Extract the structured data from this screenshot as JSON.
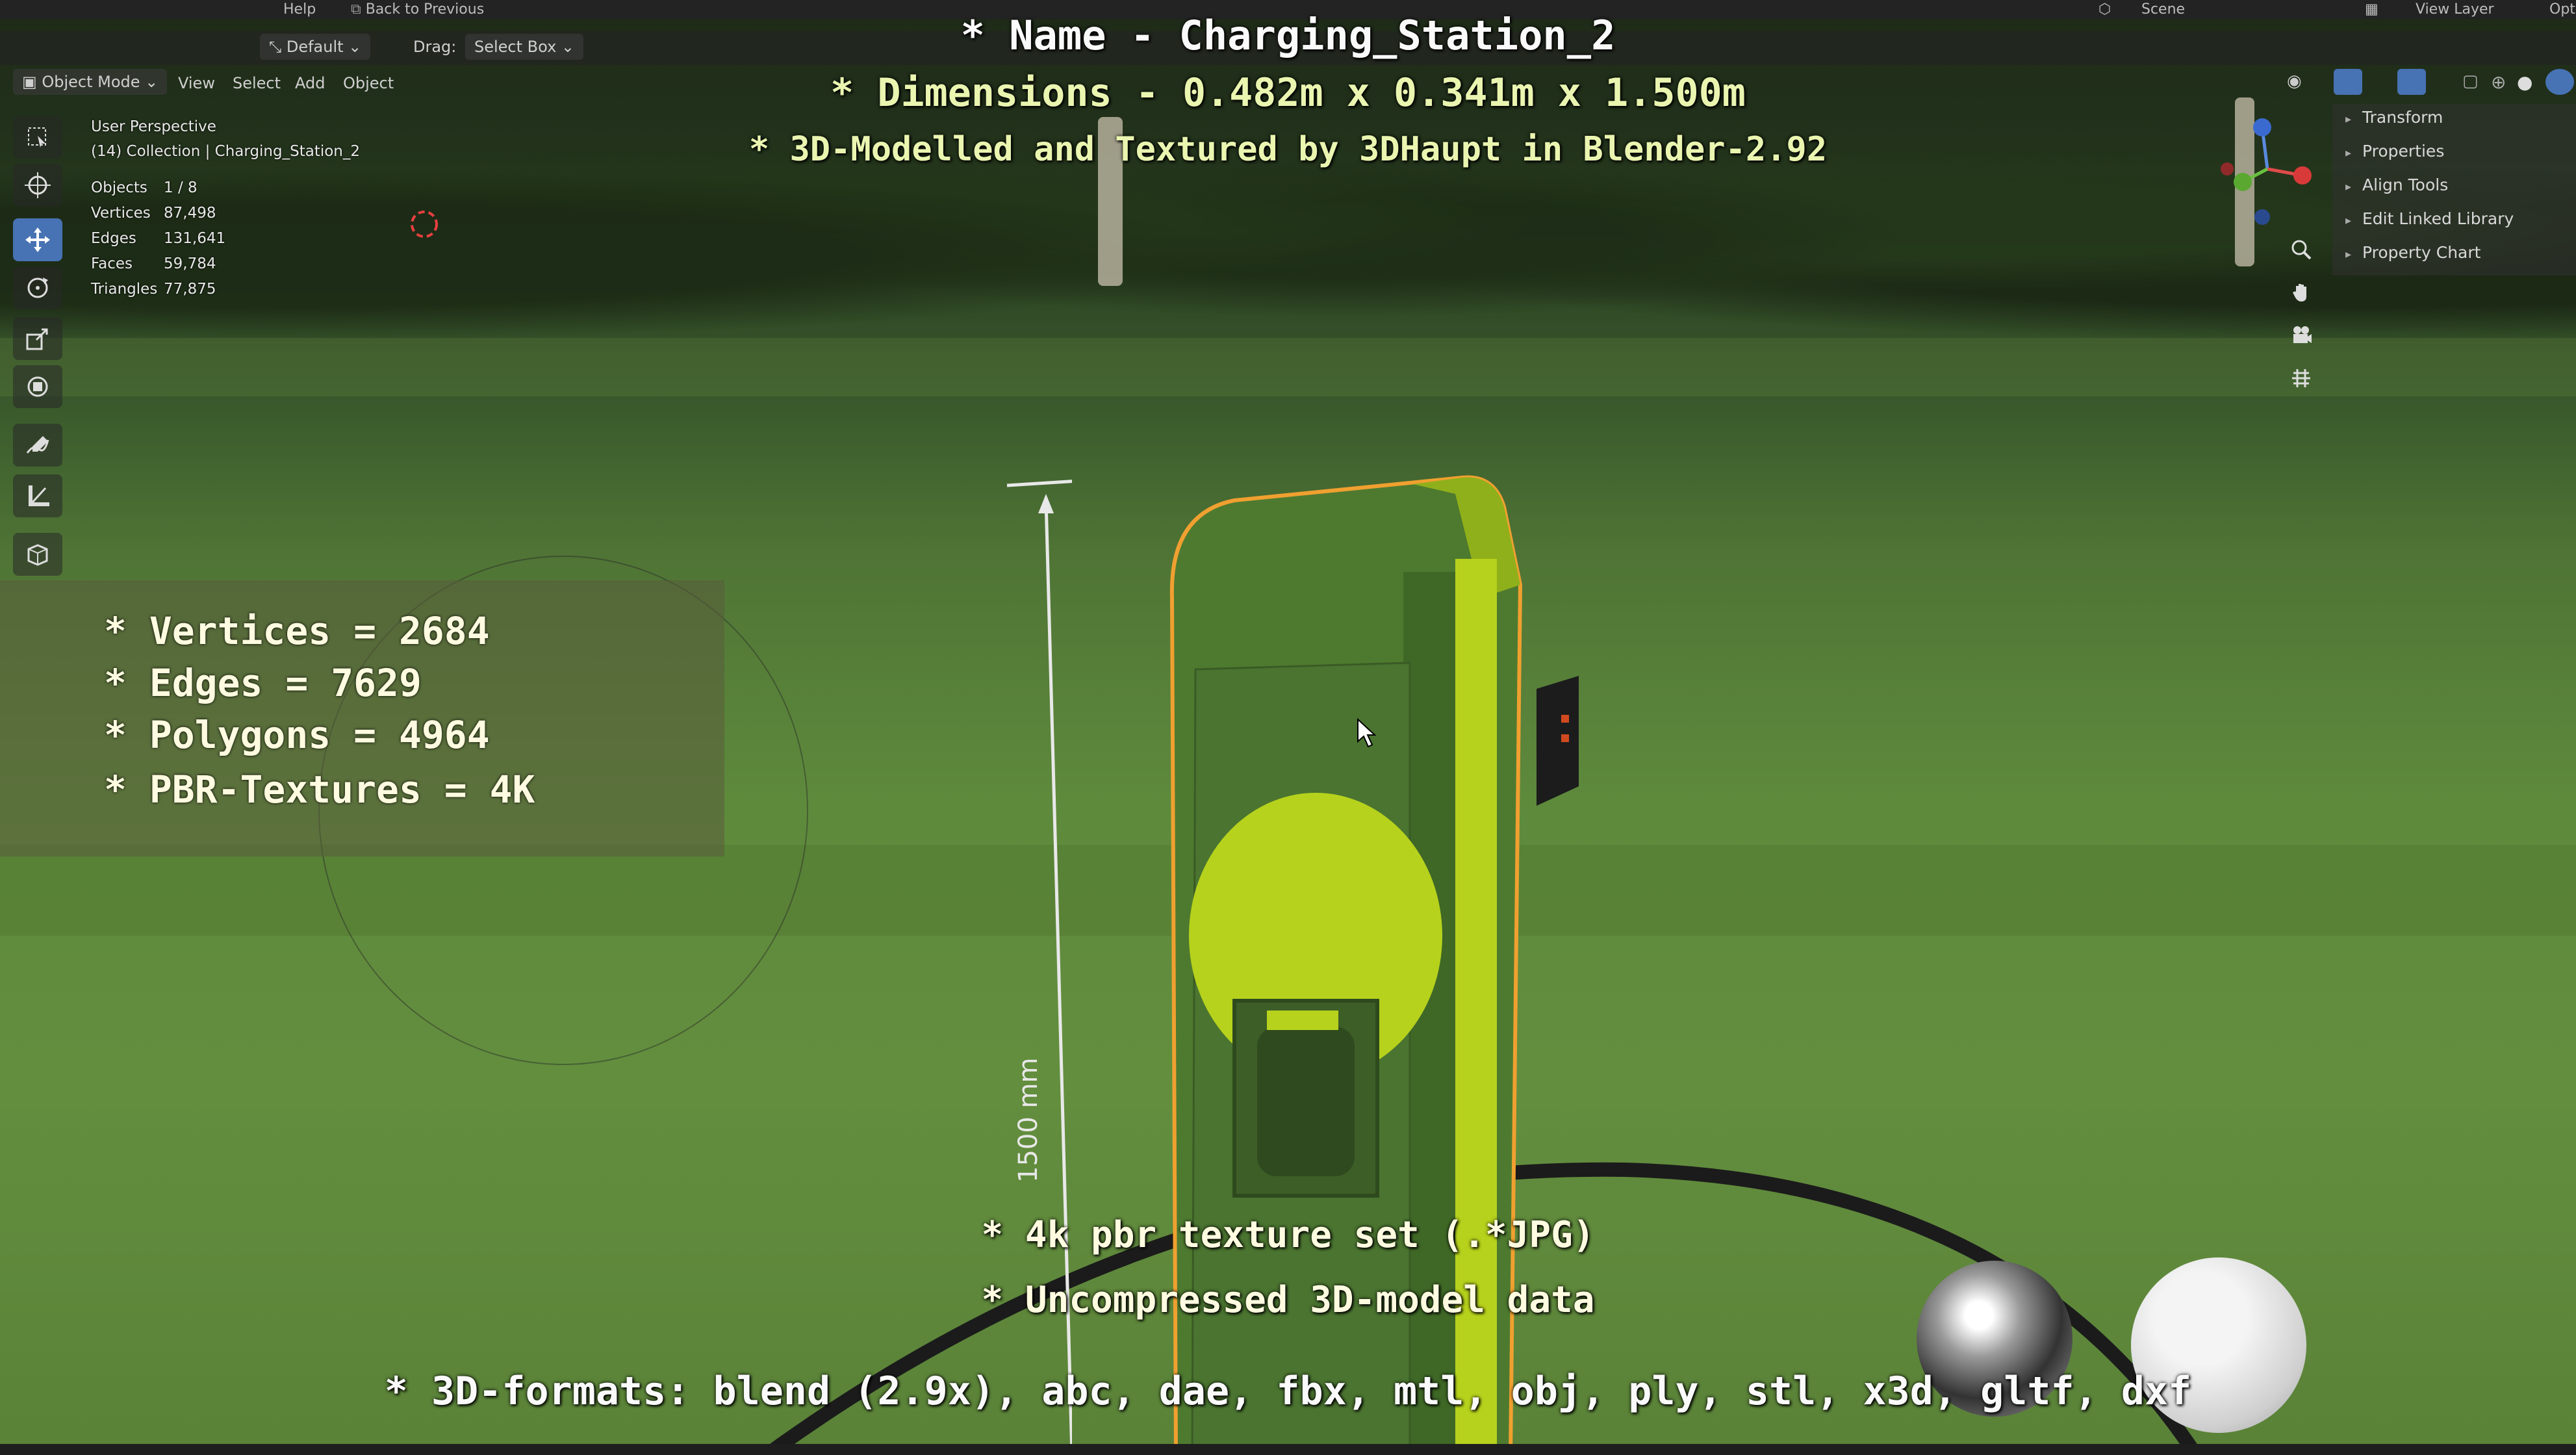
{
  "topbar": {
    "help": "Help",
    "back": "Back to Previous",
    "scene": "Scene",
    "view_layer": "View Layer",
    "opt": "Opti"
  },
  "header": {
    "mode": "Object Mode",
    "menus": [
      "View",
      "Select",
      "Add",
      "Object"
    ],
    "orientation": "Default",
    "drag_label": "Drag:",
    "drag_value": "Select Box"
  },
  "viewport": {
    "perspective": "User Perspective",
    "collection": "(14) Collection | Charging_Station_2"
  },
  "stats": [
    {
      "label": "Objects",
      "value": "1 / 8"
    },
    {
      "label": "Vertices",
      "value": "87,498"
    },
    {
      "label": "Edges",
      "value": "131,641"
    },
    {
      "label": "Faces",
      "value": "59,784"
    },
    {
      "label": "Triangles",
      "value": "77,875"
    }
  ],
  "overlay": {
    "name": "* Name - Charging_Station_2",
    "dimensions": "* Dimensions -  0.482m x 0.341m x 1.500m",
    "credit": "* 3D-Modelled and Textured by 3DHaupt in Blender-2.92",
    "poly": [
      "* Vertices = 2684",
      "* Edges = 7629",
      "* Polygons = 4964",
      "* PBR-Textures = 4K"
    ],
    "texture_set": "* 4k pbr texture set (.*JPG)",
    "uncompressed": "* Uncompressed 3D-model data",
    "formats": "* 3D-formats: blend (2.9x), abc, dae, fbx, mtl, obj, ply, stl, x3d, gltf, dxf"
  },
  "sidebar": {
    "items": [
      "Transform",
      "Properties",
      "Align Tools",
      "Edit Linked Library",
      "Property Chart"
    ]
  },
  "measure": {
    "label": "1500 mm"
  },
  "colors": {
    "accent": "#4772b3",
    "station_green": "#4e7a2f",
    "station_yellow": "#b6d21c",
    "selection_outline": "#f0a030"
  }
}
